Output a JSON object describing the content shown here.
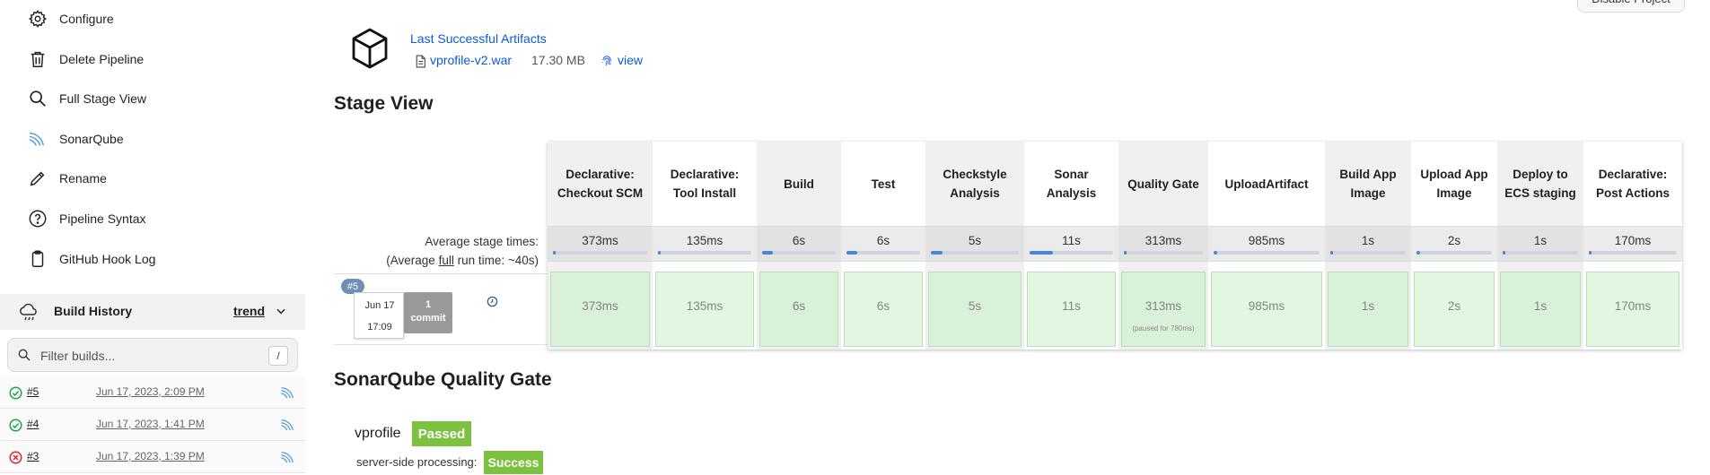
{
  "sidebar": {
    "items": [
      {
        "label": "Configure",
        "icon": "gear-icon"
      },
      {
        "label": "Delete Pipeline",
        "icon": "trash-icon"
      },
      {
        "label": "Full Stage View",
        "icon": "search-icon"
      },
      {
        "label": "SonarQube",
        "icon": "sonarqube-icon"
      },
      {
        "label": "Rename",
        "icon": "pencil-icon"
      },
      {
        "label": "Pipeline Syntax",
        "icon": "help-circle-icon"
      },
      {
        "label": "GitHub Hook Log",
        "icon": "clipboard-icon"
      }
    ]
  },
  "build_history": {
    "title": "Build History",
    "trend_label": "trend",
    "filter_placeholder": "Filter builds...",
    "filter_shortcut": "/",
    "builds": [
      {
        "number": "#5",
        "date": "Jun 17, 2023, 2:09 PM",
        "status": "success"
      },
      {
        "number": "#4",
        "date": "Jun 17, 2023, 1:41 PM",
        "status": "success"
      },
      {
        "number": "#3",
        "date": "Jun 17, 2023, 1:39 PM",
        "status": "failed"
      }
    ]
  },
  "header": {
    "disable_label": "Disable Project"
  },
  "artifacts": {
    "title": "Last Successful Artifacts",
    "file": "vprofile-v2.war",
    "size": "17.30 MB",
    "view_label": "view"
  },
  "stage_view": {
    "title": "Stage View",
    "avg_label": "Average stage times:",
    "avg_run_prefix": "(Average ",
    "avg_run_link": "full",
    "avg_run_suffix": " run time: ~40s)",
    "build": {
      "badge": "#5",
      "date": "Jun 17",
      "time": "17:09",
      "commit_count": "1",
      "commit_label": "commit"
    },
    "stages": [
      {
        "name": "Declarative: Checkout SCM",
        "avg": "373ms",
        "time": "373ms",
        "note": "",
        "fill": 0.03
      },
      {
        "name": "Declarative: Tool Install",
        "avg": "135ms",
        "time": "135ms",
        "note": "",
        "fill": 0.01
      },
      {
        "name": "Build",
        "avg": "6s",
        "time": "6s",
        "note": "",
        "fill": 0.15
      },
      {
        "name": "Test",
        "avg": "6s",
        "time": "6s",
        "note": "",
        "fill": 0.15
      },
      {
        "name": "Checkstyle Analysis",
        "avg": "5s",
        "time": "5s",
        "note": "",
        "fill": 0.13
      },
      {
        "name": "Sonar Analysis",
        "avg": "11s",
        "time": "11s",
        "note": "",
        "fill": 0.28
      },
      {
        "name": "Quality Gate",
        "avg": "313ms",
        "time": "313ms",
        "note": "(paused for 780ms)",
        "fill": 0.02
      },
      {
        "name": "UploadArtifact",
        "avg": "985ms",
        "time": "985ms",
        "note": "",
        "fill": 0.03
      },
      {
        "name": "Build App Image",
        "avg": "1s",
        "time": "1s",
        "note": "",
        "fill": 0.03
      },
      {
        "name": "Upload App Image",
        "avg": "2s",
        "time": "2s",
        "note": "",
        "fill": 0.05
      },
      {
        "name": "Deploy to ECS staging",
        "avg": "1s",
        "time": "1s",
        "note": "",
        "fill": 0.03
      },
      {
        "name": "Declarative: Post Actions",
        "avg": "170ms",
        "time": "170ms",
        "note": "",
        "fill": 0.01
      }
    ]
  },
  "quality_gate": {
    "title": "SonarQube Quality Gate",
    "project": "vprofile",
    "status": "Passed",
    "processing_label": "server-side processing:",
    "processing_status": "Success"
  },
  "colors": {
    "link": "#0b5bd4",
    "success": "#7cc13f",
    "progress": "#4a86d8",
    "stage_success": "#e2f7e2"
  }
}
